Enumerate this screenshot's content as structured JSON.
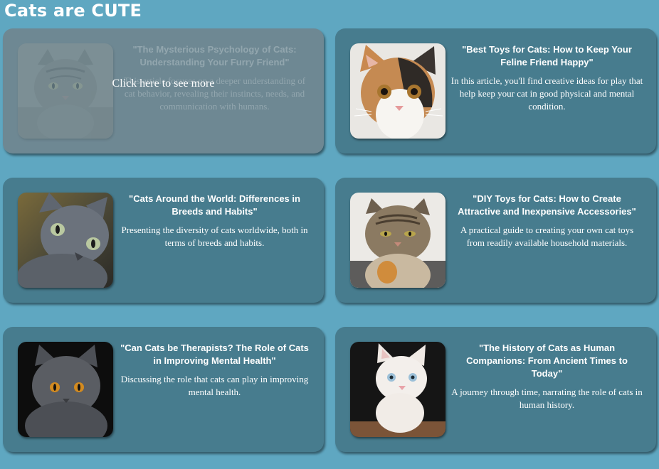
{
  "site_title": "Cats are CUTE",
  "hover_text": "Click here to see more",
  "articles": [
    {
      "title": "\"The Mysterious Psychology of Cats: Understanding Your Furry Friend\"",
      "description": "This article focuses on a deeper understanding of cat behavior, revealing their instincts, needs, and communication with humans.",
      "image_icon": "tabby-cat-photo",
      "hovered": true
    },
    {
      "title": "\"Best Toys for Cats: How to Keep Your Feline Friend Happy\"",
      "description": "In this article, you'll find creative ideas for play that help keep your cat in good physical and mental condition.",
      "image_icon": "calico-kitten-photo",
      "hovered": false
    },
    {
      "title": "\"Cats Around the World: Differences in Breeds and Habits\"",
      "description": "Presenting the diversity of cats worldwide, both in terms of breeds and habits.",
      "image_icon": "gray-cat-photo",
      "hovered": false
    },
    {
      "title": "\"DIY Toys for Cats: How to Create Attractive and Inexpensive Accessories\"",
      "description": "A practical guide to creating your own cat toys from readily available household materials.",
      "image_icon": "grumpy-tabby-cat-photo",
      "hovered": false
    },
    {
      "title": "\"Can Cats be Therapists? The Role of Cats in Improving Mental Health\"",
      "description": "Discussing the role that cats can play in improving mental health.",
      "image_icon": "dark-gray-cat-photo",
      "hovered": false
    },
    {
      "title": "\"The History of Cats as Human Companions: From Ancient Times to Today\"",
      "description": "A journey through time, narrating the role of cats in human history.",
      "image_icon": "white-kitten-photo",
      "hovered": false
    }
  ]
}
